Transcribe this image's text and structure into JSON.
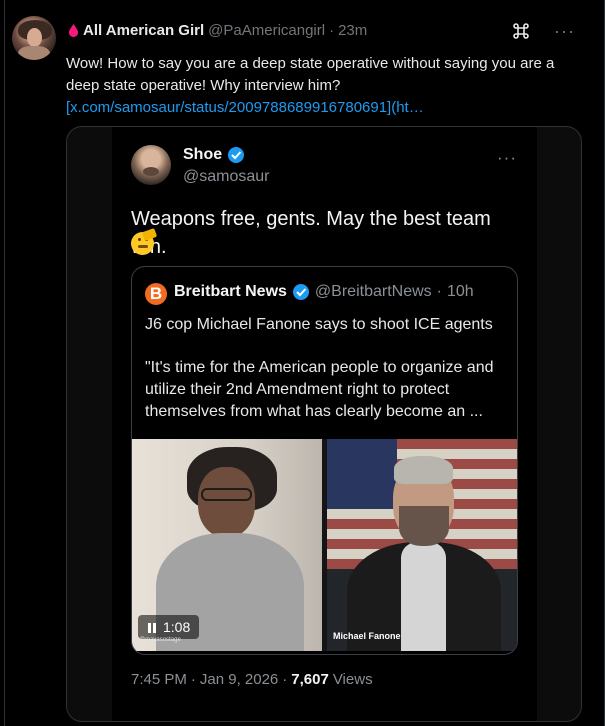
{
  "post": {
    "display_name": "All American Girl",
    "handle": "@PaAmericangirl",
    "separator": "·",
    "time": "23m",
    "text": "Wow!  How to say you are a deep state operative without saying you are a deep state operative!  Why interview him?",
    "link": "[x.com/samosaur/status/2009788689916780691](ht…",
    "actions": {
      "command_icon": "command-icon",
      "more_label": "···"
    }
  },
  "embedded": {
    "name": "Shoe",
    "handle": "@samosaur",
    "more_label": "···",
    "text": "Weapons free, gents. May the best team win.",
    "emoji": "saluting-face-emoji",
    "quote": {
      "logo_letter": "B",
      "name": "Breitbart News",
      "handle": "@BreitbartNews",
      "separator": "·",
      "time": "10h",
      "headline": "J6 cop Michael Fanone says to shoot ICE agents",
      "quote": "\"It's time for the American people to organize and utilize their 2nd Amendment right to protect themselves from what has clearly become an ...",
      "video": {
        "duration": "1:08",
        "right_label": "Michael Fanone",
        "left_tiny_label": "@mayasostage"
      }
    },
    "meta": {
      "time": "7:45 PM",
      "separator1": "·",
      "date": "Jan 9, 2026",
      "separator2": "·",
      "views_count": "7,607",
      "views_label": "Views"
    }
  },
  "colors": {
    "background": "#000000",
    "text": "#e7e9ea",
    "muted": "#71767b",
    "link": "#1d9bf0",
    "verified": "#1d9bf0",
    "breitbart": "#f36b21"
  }
}
